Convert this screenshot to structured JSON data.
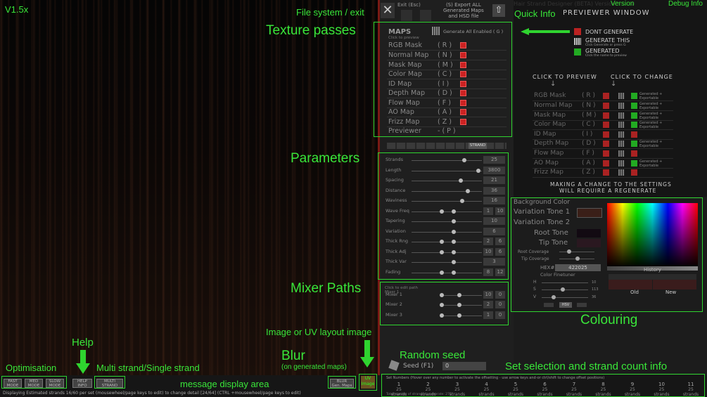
{
  "version_tag": "V1.5x",
  "window_title": "Hair Strand Designer (BETA) Version",
  "title_suffix": "0",
  "version_label": "Version",
  "debug_label": "Debug Info",
  "annotations": {
    "texture_passes": "Texture passes",
    "file_system": "File system / exit",
    "quick_info": "Quick Info",
    "parameters": "Parameters",
    "mixer_paths": "Mixer Paths",
    "colouring": "Colouring",
    "image_uv": "Image or UV layout image",
    "blur": "Blur",
    "blur_sub": "(on generated maps)",
    "random_seed": "Random seed",
    "set_selection": "Set selection and strand count info",
    "help": "Help",
    "optimisation": "Optimisation",
    "multi_strand": "Multi strand/Single strand",
    "message_area": "message display area"
  },
  "toolbar": {
    "exit_label": "Exit (Esc)",
    "export_label_1": "(S) Export ALL",
    "export_label_2": "Generated Maps",
    "export_label_3": "and HSD file"
  },
  "maps": {
    "header": "MAPS",
    "subheader": "Click to preview",
    "generate_all": "Generate All Enabled ( G )",
    "items": [
      {
        "name": "RGB Mask",
        "key": "( R )"
      },
      {
        "name": "Normal Map",
        "key": "( N )"
      },
      {
        "name": "Mask Map",
        "key": "( M )"
      },
      {
        "name": "Color Map",
        "key": "( C )"
      },
      {
        "name": "ID Map",
        "key": "( I )"
      },
      {
        "name": "Depth Map",
        "key": "( D )"
      },
      {
        "name": "Flow Map",
        "key": "( F )"
      },
      {
        "name": "AO Map",
        "key": "( A )"
      },
      {
        "name": "Frizz Map",
        "key": "( Z )"
      },
      {
        "name": "Previewer",
        "key": "- ( P )"
      }
    ],
    "strand_toggle": "STRAND"
  },
  "params": [
    {
      "name": "Strands",
      "value": "25",
      "pos": 0.75
    },
    {
      "name": "Length",
      "value": "3800",
      "pos": 0.95
    },
    {
      "name": "Spacing",
      "value": "21",
      "pos": 0.7
    },
    {
      "name": "Distance",
      "value": "36",
      "pos": 0.8
    },
    {
      "name": "Waviness",
      "value": "16",
      "pos": 0.72
    },
    {
      "name": "Wave Freq",
      "value": "1",
      "value2": "10",
      "pos": 0.6
    },
    {
      "name": "Tapering",
      "value": "10",
      "pos": 0.6
    },
    {
      "name": "Variation",
      "value": "6",
      "pos": 0.6
    },
    {
      "name": "Thick Rng",
      "value": "2",
      "value2": "6",
      "pos": 0.6
    },
    {
      "name": "Thick Adj",
      "value": "10",
      "value2": "6",
      "pos": 0.6
    },
    {
      "name": "Thick Var",
      "value": "3",
      "pos": 0.6
    },
    {
      "name": "Fading",
      "value": "8",
      "value2": "12",
      "pos": 0.6
    }
  ],
  "mixer": {
    "hint_1": "Click to edit path",
    "hint_2": "Mixer 1",
    "rows": [
      {
        "name": "Mixer 1",
        "v1": "10",
        "v2": "0"
      },
      {
        "name": "Mixer 2",
        "v1": "2",
        "v2": "0"
      },
      {
        "name": "Mixer 3",
        "v1": "1",
        "v2": "0"
      }
    ]
  },
  "previewer": {
    "title": "PREVIEWER WINDOW",
    "legend_dont": "DONT GENERATE",
    "legend_generate": "GENERATE THIS",
    "legend_generate_sub": "Click Generate or press G",
    "legend_generated": "GENERATED",
    "legend_generated_sub": "Click the name to preview",
    "click_preview": "CLICK TO PREVIEW",
    "click_change": "CLICK TO CHANGE",
    "rows": [
      {
        "name": "RGB Mask",
        "key": "( R )",
        "status": "Generated + Exportable"
      },
      {
        "name": "Normal Map",
        "key": "( N )",
        "status": "Generated + Exportable"
      },
      {
        "name": "Mask Map",
        "key": "( M )",
        "status": "Generated + Exportable"
      },
      {
        "name": "Color Map",
        "key": "( C )",
        "status": "Generated + Exportable"
      },
      {
        "name": "ID Map",
        "key": "( I )",
        "status": ""
      },
      {
        "name": "Depth Map",
        "key": "( D )",
        "status": "Generated + Exportable"
      },
      {
        "name": "Flow Map",
        "key": "( F )",
        "status": ""
      },
      {
        "name": "AO Map",
        "key": "( A )",
        "status": "Generated + Exportable"
      },
      {
        "name": "Frizz Map",
        "key": "( Z )",
        "status": ""
      }
    ],
    "footer_1": "MAKING A CHANGE TO THE SETTINGS",
    "footer_2": "WILL REQUIRE A REGENERATE"
  },
  "colour": {
    "background_color": "Background Color",
    "variation_1": "Variation Tone 1",
    "variation_2": "Variation Tone 2",
    "root_tone": "Root Tone",
    "tip_tone": "Tip Tone",
    "root_coverage": "Root Coverage",
    "tip_coverage": "Tip Coverage",
    "hex_label": "HEX#",
    "hex_value": "422025",
    "finetuner": "Color Finetuner",
    "h_label": "H",
    "s_label": "S",
    "v_label": "V",
    "h_value": "10",
    "s_value": "113",
    "v_value": "36",
    "history": "History",
    "old": "Old",
    "new": "New",
    "hsv": "HSV",
    "colors": {
      "tone1": "#3a1f18",
      "root": "#120a12",
      "tip": "#2a1820",
      "old": "#3a1c1c",
      "new": "#3a1c1c"
    }
  },
  "bottom": {
    "fast": "FAST",
    "fast_sub": "MODE",
    "med": "MED",
    "med_sub": "MODE",
    "slow": "SLOW",
    "slow_sub": "MODE",
    "help": "HELP",
    "help_sub": "INFO",
    "multi": "MULTI",
    "multi_sub": "STRAND",
    "blur": "BLUR",
    "blur_sub": "Gen. Maps",
    "uv": "UV",
    "uv_sub": "Image",
    "status_line": "Displaying Estimated strands 16/60 per set (mousewheel/page keys to edit) to change detail [24/64] (CTRL +mousewheel/page keys to edit)"
  },
  "seed": {
    "label": "Seed (F1)",
    "value": "0"
  },
  "sets": {
    "header": "Set Numbers (Hover over any number to activate the offsetting - use arrow keys and-or ctrl/shift to change offset positions)",
    "numbers": [
      "1",
      "2",
      "3",
      "4",
      "5",
      "6",
      "7",
      "8",
      "9",
      "10",
      "11"
    ],
    "count_label": "25 strands",
    "total": "Total number of strands to generate: 275"
  }
}
